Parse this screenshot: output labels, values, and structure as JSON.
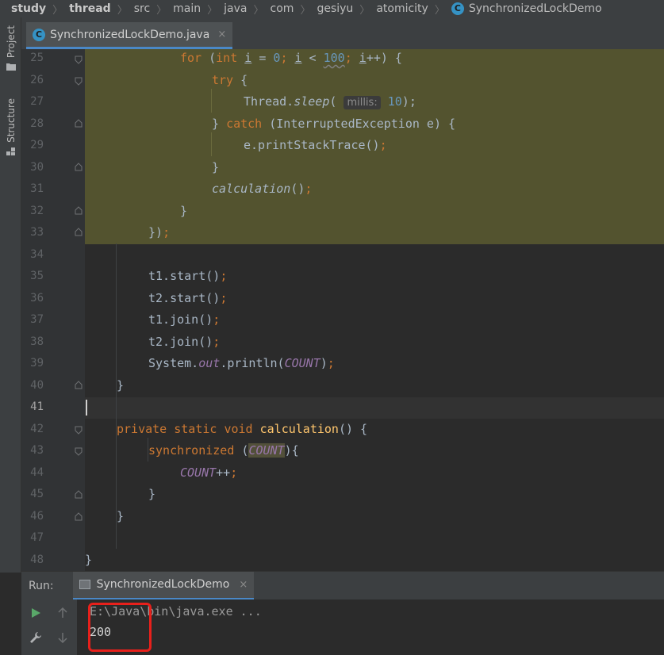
{
  "breadcrumb": {
    "items": [
      "study",
      "thread",
      "src",
      "main",
      "java",
      "com",
      "gesiyu",
      "atomicity",
      "SynchronizedLockDemo"
    ]
  },
  "left_strip": {
    "project_label": "Project",
    "structure_label": "Structure"
  },
  "tab": {
    "label": "SynchronizedLockDemo.java",
    "close": "×"
  },
  "editor": {
    "line_numbers": [
      "25",
      "26",
      "27",
      "28",
      "29",
      "30",
      "31",
      "32",
      "33",
      "34",
      "35",
      "36",
      "37",
      "38",
      "39",
      "40",
      "41",
      "42",
      "43",
      "44",
      "45",
      "46",
      "47",
      "48"
    ],
    "current_line": "41",
    "hint_millis": "millis:",
    "lines": {
      "l25_for": "for",
      "l25_open": " (",
      "l25_int": "int",
      "l25_i1": "i",
      "l25_eq": " = ",
      "l25_zero": "0",
      "l25_semi1": "; ",
      "l25_i2": "i",
      "l25_lt": " < ",
      "l25_hundred": "100",
      "l25_semi2": "; ",
      "l25_i3": "i",
      "l25_inc": "++) {",
      "l26_try": "try",
      "l26_brace": " {",
      "l27_thread": "Thread.",
      "l27_sleep": "sleep",
      "l27_paren": "( ",
      "l27_ten": "10",
      "l27_close": ");",
      "l28_brace": "} ",
      "l28_catch": "catch",
      "l28_rest": " (InterruptedException e) {",
      "l29_stmt": "e.printStackTrace()",
      "l29_semi": ";",
      "l30": "}",
      "l31_calc": "calculation",
      "l31_paren": "()",
      "l31_semi": ";",
      "l32": "}",
      "l33_close": "})",
      "l33_semi": ";",
      "l35": "t1.start()",
      "l36": "t2.start()",
      "l37": "t1.join()",
      "l38": "t2.join()",
      "semi": ";",
      "l39_sys": "System.",
      "l39_out": "out",
      "l39_println": ".println(",
      "l39_count": "COUNT",
      "l39_close": ")",
      "l40": "}",
      "l42_private": "private",
      "l42_static": "static",
      "l42_void": "void",
      "l42_name": "calculation",
      "l42_rest": "() {",
      "l43_sync": "synchronized",
      "l43_open": " (",
      "l43_count": "COUNT",
      "l43_close": "){",
      "l44_count": "COUNT",
      "l44_inc": "++",
      "l45": "}",
      "l46": "}",
      "l48": "}"
    }
  },
  "run_panel": {
    "label": "Run:",
    "tab_label": "SynchronizedLockDemo",
    "close": "×",
    "console": {
      "command": "E:\\Java\\bin\\java.exe ...",
      "output": "200"
    }
  },
  "colors": {
    "keyword": "#cc7832",
    "number": "#6897bb",
    "function": "#ffc66d",
    "static_field": "#9876aa",
    "highlight": "#53532f",
    "annotation_box": "#e8201b"
  }
}
